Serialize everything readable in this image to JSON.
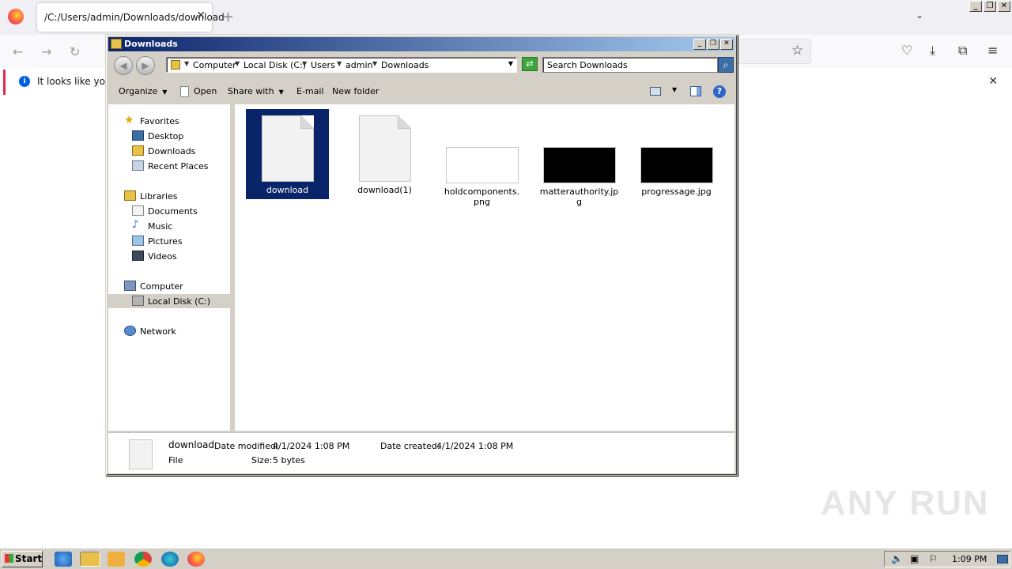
{
  "browser": {
    "tab_title": "/C:/Users/admin/Downloads/download",
    "tab_close": "✕",
    "new_tab": "+",
    "tab_list": "⌄",
    "notification_text": "It looks like you ha",
    "notification_close": "✕"
  },
  "window_controls": {
    "minimize": "_",
    "restore": "❐",
    "close": "✕"
  },
  "explorer": {
    "title": "Downloads",
    "breadcrumb": [
      "Computer",
      "Local Disk (C:)",
      "Users",
      "admin",
      "Downloads"
    ],
    "search_placeholder": "Search Downloads",
    "toolbar": {
      "organize": "Organize",
      "open": "Open",
      "share_with": "Share with",
      "email": "E-mail",
      "new_folder": "New folder"
    },
    "nav": {
      "favorites": "Favorites",
      "desktop": "Desktop",
      "downloads": "Downloads",
      "recent_places": "Recent Places",
      "libraries": "Libraries",
      "documents": "Documents",
      "music": "Music",
      "pictures": "Pictures",
      "videos": "Videos",
      "computer": "Computer",
      "local_disk": "Local Disk (C:)",
      "network": "Network"
    },
    "files": [
      {
        "name": "download",
        "kind": "file",
        "selected": true
      },
      {
        "name": "download(1)",
        "kind": "file",
        "selected": false
      },
      {
        "name": "holdcomponents.png",
        "kind": "image-white",
        "selected": false
      },
      {
        "name": "matterauthority.jpg",
        "kind": "image-black",
        "selected": false
      },
      {
        "name": "progressage.jpg",
        "kind": "image-black",
        "selected": false
      }
    ],
    "details": {
      "name": "download",
      "type": "File",
      "date_modified_label": "Date modified:",
      "date_modified": "4/1/2024 1:08 PM",
      "date_created_label": "Date created:",
      "date_created": "4/1/2024 1:08 PM",
      "size_label": "Size:",
      "size": "5 bytes"
    }
  },
  "watermark": "ANY RUN",
  "taskbar": {
    "start": "Start",
    "clock": "1:09 PM"
  },
  "colors": {
    "selection": "#0a246a",
    "titlebar_start": "#0a246a",
    "titlebar_end": "#a6caf0",
    "firefox_accent": "#e22850"
  }
}
